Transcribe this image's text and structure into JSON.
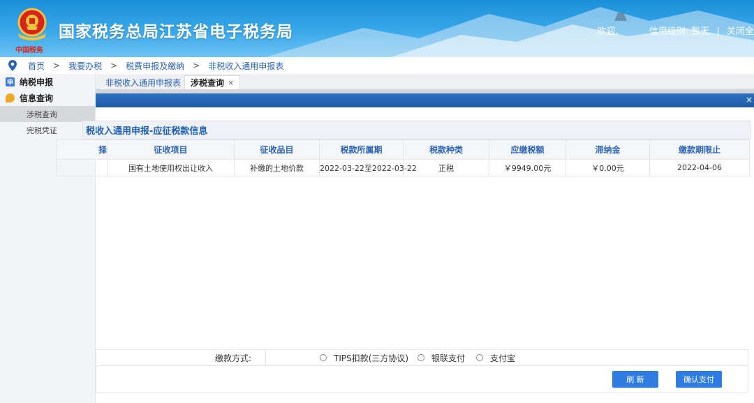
{
  "header": {
    "title": "国家税务总局江苏省电子税务局",
    "slogan": "中国税务",
    "welcome": "欢迎,",
    "credit_label": "信用级别:",
    "credit_value": "暂无",
    "separator": "|",
    "close_label": "关闭全"
  },
  "breadcrumb": [
    "首页",
    "我要办税",
    "税费申报及缴纳",
    "非税收入通用申报表"
  ],
  "breadcrumb_sep": ">",
  "sidebar": {
    "groups": [
      {
        "label": "纳税申报",
        "icon": "申"
      },
      {
        "label": "信息查询",
        "icon": ""
      }
    ],
    "items": [
      "涉税查询",
      "完税凭证"
    ]
  },
  "tabs": [
    {
      "label": "非税收入通用申报表"
    },
    {
      "label": "涉税查询",
      "close": "×"
    }
  ],
  "panel_close": "×",
  "section_title": "税收入通用申报-应征税款信息",
  "table": {
    "headers": [
      "择",
      "征收项目",
      "征收品目",
      "税款所属期",
      "税款种类",
      "应缴税额",
      "滞纳金",
      "缴款期限止"
    ],
    "rows": [
      [
        "",
        "国有土地使用权出让收入",
        "补缴的土地价款",
        "2022-03-22至2022-03-22",
        "正税",
        "￥9949.00元",
        "￥0.00元",
        "2022-04-06"
      ]
    ]
  },
  "payment": {
    "label": "缴款方式:",
    "options": [
      "TIPS扣款(三方协议)",
      "银联支付",
      "支付宝"
    ]
  },
  "buttons": {
    "refresh": "刷 新",
    "confirm": "确认支付"
  },
  "colors": {
    "accent": "#2f7de0",
    "link": "#2a63b5",
    "section": "#1f5fb4",
    "header": "#1a8fd8"
  }
}
